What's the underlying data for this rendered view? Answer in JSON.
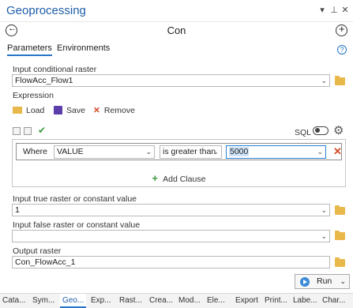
{
  "window": {
    "title": "Geoprocessing",
    "pin_glyph": "▾",
    "pin2_glyph": "⊥",
    "close_glyph": "✕"
  },
  "tool": {
    "name": "Con",
    "back_glyph": "←",
    "add_glyph": "+"
  },
  "tabs": {
    "parameters": "Parameters",
    "environments": "Environments",
    "help_glyph": "?"
  },
  "params": {
    "conditional_label": "Input conditional raster",
    "conditional_value": "FlowAcc_Flow1",
    "expression_label": "Expression",
    "load_label": "Load",
    "save_label": "Save",
    "remove_label": "Remove",
    "sql_label": "SQL",
    "check_glyph": "✔",
    "gear_glyph": "⚙",
    "where_label": "Where",
    "field_value": "VALUE",
    "operator_value": "is greater than",
    "clause_value": "5000",
    "clause_remove_glyph": "✕",
    "add_clause_label": "Add Clause",
    "add_clause_glyph": "+",
    "true_label": "Input true raster or constant value",
    "true_value": "1",
    "false_label": "Input false raster or constant value",
    "false_value": "",
    "output_label": "Output raster",
    "output_value": "Con_FlowAcc_1",
    "chevron_glyph": "⌄"
  },
  "run": {
    "label": "Run"
  },
  "bottom_tabs": [
    "Cata...",
    "Sym...",
    "Geo...",
    "Exp...",
    "Rast...",
    "Crea...",
    "Mod...",
    "Ele...",
    "Export",
    "Print...",
    "Labe...",
    "Char..."
  ],
  "colors": {
    "accent": "#2475c7",
    "title": "#1f5ea8",
    "folder": "#e9b84b",
    "remove": "#d04a25",
    "add": "#3a9a3a",
    "highlight": "#cfe3f7"
  }
}
